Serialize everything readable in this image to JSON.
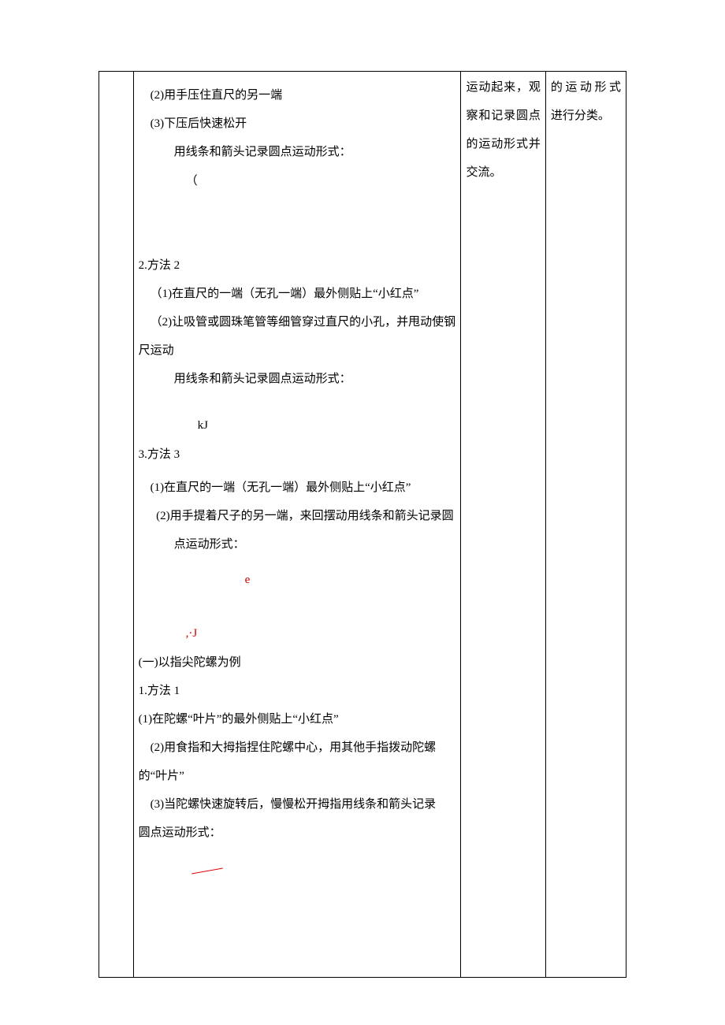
{
  "col2": {
    "p1": "(2)用手压住直尺的另一端",
    "p2": "(3)下压后快速松开",
    "p3": "用线条和箭头记录圆点运动形式：",
    "g1": "（",
    "m2_title": "2.方法 2",
    "m2_p1": "（1)在直尺的一端（无孔一端）最外侧贴上“小红点”",
    "m2_p2": "（2)让吸管或圆珠笔管等细管穿过直尺的小孔，并甩动使钢尺运动",
    "m2_p3": "用线条和箭头记录圆点运动形式：",
    "g2": "kJ",
    "m3_title": "3.方法 3",
    "m3_p1": "(1)在直尺的一端（无孔一端）最外侧贴上“小红点”",
    "m3_p2": "(2)用手提着尺子的另一端，来回摆动用线条和箭头记录圆点运动形式：",
    "g3a": "e",
    "g3b": ",·J",
    "sec_title": "(一)以指尖陀螺为例",
    "sf1_title": "1.方法 1",
    "sf1_p1": "(1)在陀螺“叶片”的最外侧贴上“小红点”",
    "sf1_p2": "(2)用食指和大拇指捏住陀螺中心，用其他手指拨动陀螺的“叶片”",
    "sf1_p3": "(3)当陀螺快速旋转后，慢慢松开拇指用线条和箭头记录圆点运动形式："
  },
  "col3": {
    "t1": "运动起来，观察和记录圆点的运动形式并交流。"
  },
  "col4": {
    "t1": "的运动形式进行分类。"
  }
}
